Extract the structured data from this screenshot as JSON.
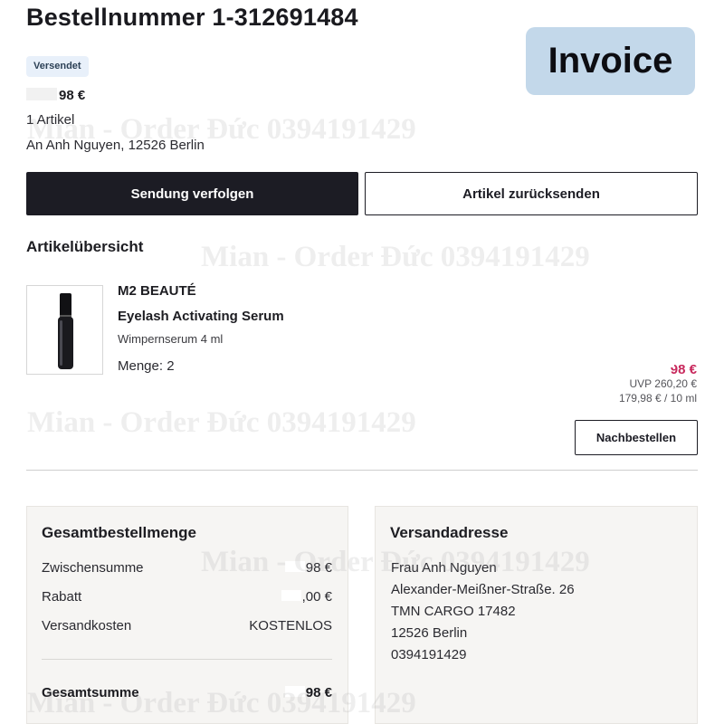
{
  "header": {
    "title": "Bestellnummer 1-312691484",
    "invoice_label": "Invoice",
    "status": "Versendet",
    "total_visible": "98 €",
    "item_count": "1 Artikel",
    "recipient_summary": "An Anh Nguyen, 12526 Berlin"
  },
  "actions": {
    "track": "Sendung verfolgen",
    "return": "Artikel zurücksenden"
  },
  "overview": {
    "title": "Artikelübersicht",
    "item": {
      "brand": "M2 BEAUTÉ",
      "name": "Eyelash Activating Serum",
      "description": "Wimpernserum 4 ml",
      "quantity": "Menge: 2",
      "price": "98 €",
      "rrp": "UVP 260,20 €",
      "unit_price": "179,98 € / 10 ml",
      "reorder": "Nachbestellen"
    }
  },
  "totals": {
    "title": "Gesamtbestellmenge",
    "rows": [
      {
        "label": "Zwischensumme",
        "value": "98 €"
      },
      {
        "label": "Rabatt",
        "value": ",00 €"
      },
      {
        "label": "Versandkosten",
        "value": "KOSTENLOS"
      }
    ],
    "total_label": "Gesamtsumme",
    "total_value": "98 €"
  },
  "shipping": {
    "title": "Versandadresse",
    "lines": [
      "Frau Anh Nguyen",
      "Alexander-Meißner-Straße. 26",
      "TMN CARGO 17482",
      "12526 Berlin",
      "0394191429"
    ]
  },
  "watermark": "Mian - Order Đức 0394191429",
  "colors": {
    "primary_button": "#1c1c24",
    "invoice_badge": "#c3d8ea",
    "status_badge": "#e8f0fa",
    "sale_price": "#c8285c",
    "card_background": "#f6f5f3"
  },
  "icons": {
    "product_image": "serum-bottle-icon"
  }
}
